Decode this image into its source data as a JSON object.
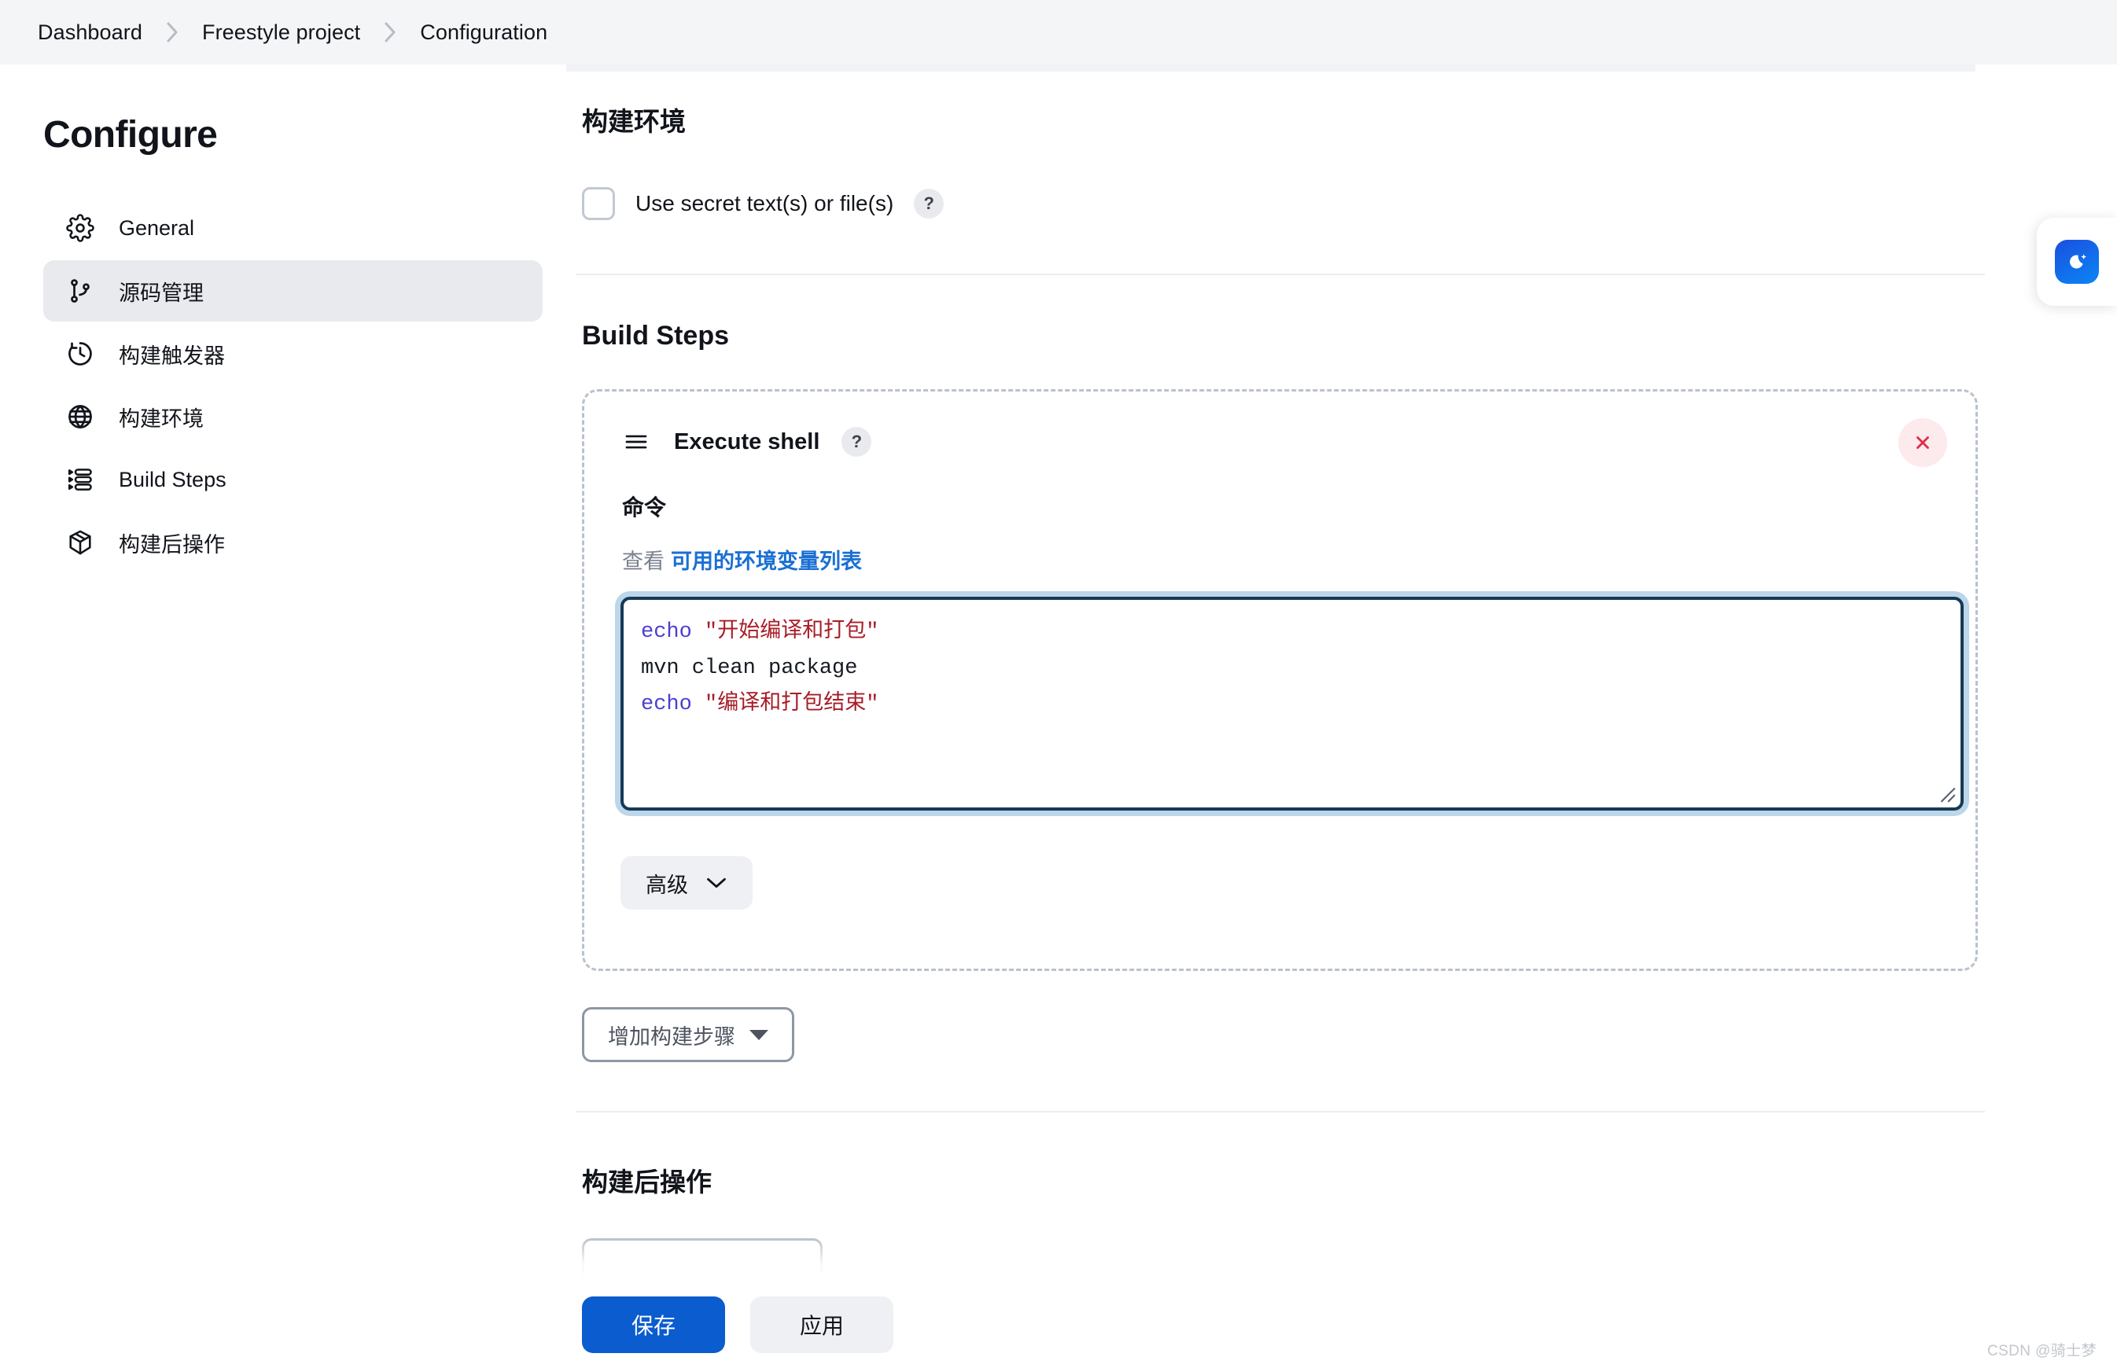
{
  "breadcrumb": {
    "items": [
      {
        "label": "Dashboard"
      },
      {
        "label": "Freestyle project"
      },
      {
        "label": "Configuration"
      }
    ]
  },
  "sidebar": {
    "title": "Configure",
    "items": [
      {
        "label": "General",
        "icon": "gear-icon",
        "active": false
      },
      {
        "label": "源码管理",
        "icon": "git-branch-icon",
        "active": true
      },
      {
        "label": "构建触发器",
        "icon": "clock-icon",
        "active": false
      },
      {
        "label": "构建环境",
        "icon": "globe-icon",
        "active": false
      },
      {
        "label": "Build Steps",
        "icon": "list-steps-icon",
        "active": false
      },
      {
        "label": "构建后操作",
        "icon": "package-icon",
        "active": false
      }
    ]
  },
  "build_environment": {
    "heading": "构建环境",
    "checkbox": {
      "label": "Use secret text(s) or file(s)",
      "checked": false,
      "help_label": "?"
    }
  },
  "build_steps": {
    "heading": "Build Steps",
    "step": {
      "drag_icon": "drag-handle-icon",
      "name": "Execute shell",
      "help_label": "?",
      "close_icon": "close-icon",
      "command_label": "命令",
      "env_hint_prefix": "查看",
      "env_hint_link": "可用的环境变量列表",
      "command_lines": [
        {
          "keyword": "echo",
          "string": "\"开始编译和打包\""
        },
        {
          "plain": "mvn clean package"
        },
        {
          "keyword": "echo",
          "string": "\"编译和打包结束\""
        }
      ],
      "advanced_label": "高级"
    },
    "add_step_label": "增加构建步骤"
  },
  "post_build": {
    "heading": "构建后操作"
  },
  "footer": {
    "save_label": "保存",
    "apply_label": "应用"
  },
  "theme_toggle": {
    "icon": "moon-sparkle-icon"
  },
  "watermark": {
    "text": "CSDN @骑士梦"
  },
  "colors": {
    "accent_blue": "#0b5cce",
    "link_blue": "#1a6fd4",
    "sidebar_active_bg": "#e8eaee",
    "topbar_bg": "#f4f5f7",
    "dashed_border": "#b9c2cc",
    "code_keyword": "#4b3fd0",
    "code_string": "#a71d28",
    "close_red": "#e02c46",
    "close_bg": "#fdeaec"
  }
}
